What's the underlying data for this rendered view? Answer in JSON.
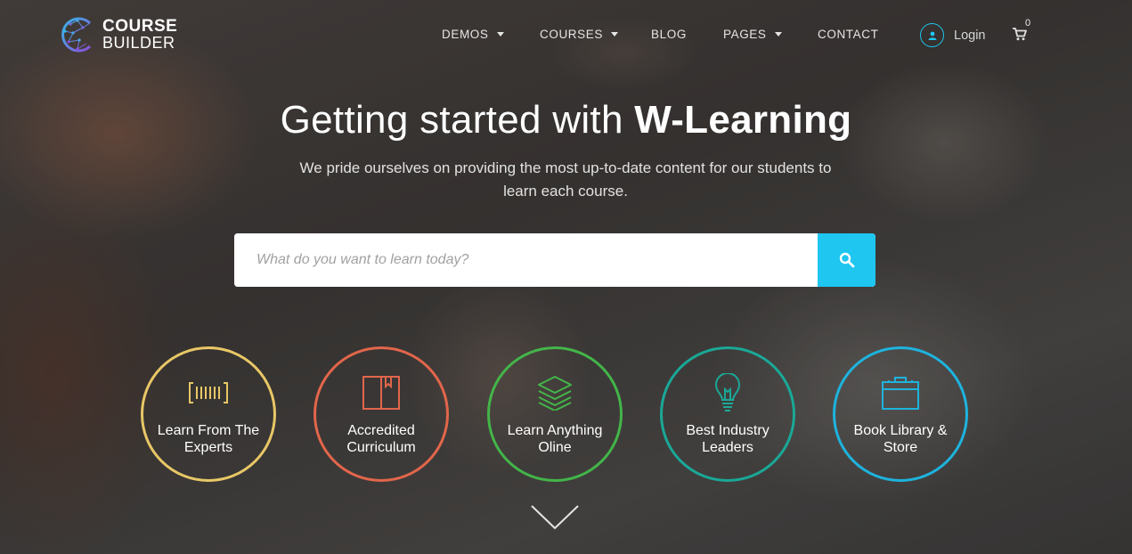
{
  "brand": {
    "line1": "COURSE",
    "line2": "BUILDER"
  },
  "nav": {
    "items": [
      {
        "label": "DEMOS",
        "dropdown": true
      },
      {
        "label": "COURSES",
        "dropdown": true
      },
      {
        "label": "BLOG",
        "dropdown": false
      },
      {
        "label": "PAGES",
        "dropdown": true
      },
      {
        "label": "CONTACT",
        "dropdown": false
      }
    ],
    "login_label": "Login",
    "cart_count": "0"
  },
  "hero": {
    "title_light": "Getting started with ",
    "title_bold": "W-Learning",
    "subtitle": "We pride ourselves on providing the most up-to-date content for our students to learn each course."
  },
  "search": {
    "placeholder": "What do you want to learn today?",
    "value": "",
    "button_icon": "search-icon"
  },
  "features": [
    {
      "label": "Learn From The Experts",
      "icon": "barcode-icon",
      "color": "#e8c766"
    },
    {
      "label": "Accredited Curriculum",
      "icon": "book-icon",
      "color": "#e2664b"
    },
    {
      "label": "Learn Anything Oline",
      "icon": "layers-icon",
      "color": "#43b549"
    },
    {
      "label": "Best Industry Leaders",
      "icon": "lightbulb-icon",
      "color": "#1aa897"
    },
    {
      "label": "Book Library & Store",
      "icon": "briefcase-icon",
      "color": "#1eb3de"
    }
  ],
  "colors": {
    "accent": "#1ec6f0"
  },
  "scroll_icon": "chevron-down-icon"
}
